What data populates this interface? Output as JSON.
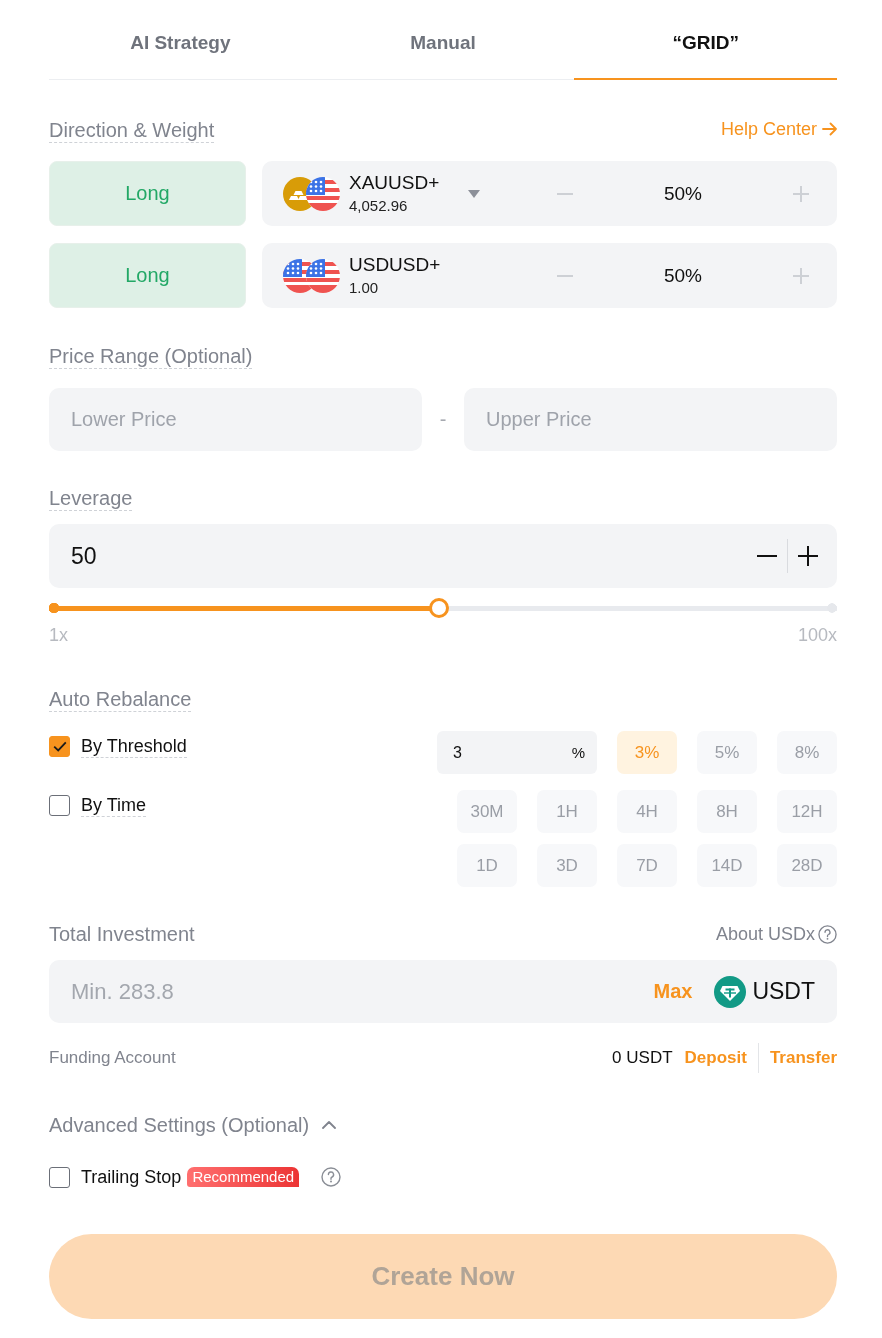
{
  "tabs": [
    {
      "label": "AI Strategy",
      "selected": false
    },
    {
      "label": "Manual",
      "selected": false
    },
    {
      "label": "“GRID”",
      "selected": true
    }
  ],
  "direction_weight": {
    "title": "Direction & Weight",
    "help_link": "Help Center",
    "rows": [
      {
        "direction": "Long",
        "asset": {
          "symbol": "XAUUSD+",
          "price": "4,052.96",
          "kind": "metal",
          "dropdown": true
        },
        "weight": "50%"
      },
      {
        "direction": "Long",
        "asset": {
          "symbol": "USDUSD+",
          "price": "1.00",
          "kind": "fiat",
          "dropdown": false
        },
        "weight": "50%"
      }
    ]
  },
  "price_range": {
    "title": "Price Range (Optional)",
    "lower": {
      "placeholder": "Lower Price"
    },
    "separator": "-",
    "upper": {
      "placeholder": "Upper Price"
    }
  },
  "leverage": {
    "title": "Leverage",
    "value": "50",
    "slider": {
      "level": 0.495,
      "min_label": "1x",
      "max_label": "100x"
    }
  },
  "auto_rebalance": {
    "title": "Auto Rebalance",
    "threshold": {
      "label": "By Threshold",
      "checked": true,
      "input": {
        "value": "3",
        "unit": "%"
      },
      "options": [
        {
          "label": "3%",
          "selected": true
        },
        {
          "label": "5%",
          "selected": false
        },
        {
          "label": "8%",
          "selected": false
        }
      ]
    },
    "time": {
      "label": "By Time",
      "checked": false,
      "options": [
        {
          "label": "30M",
          "selected": false
        },
        {
          "label": "1H",
          "selected": false
        },
        {
          "label": "4H",
          "selected": false
        },
        {
          "label": "8H",
          "selected": false
        },
        {
          "label": "12H",
          "selected": false
        },
        {
          "label": "1D",
          "selected": false
        },
        {
          "label": "3D",
          "selected": false
        },
        {
          "label": "7D",
          "selected": false
        },
        {
          "label": "14D",
          "selected": false
        },
        {
          "label": "28D",
          "selected": false
        }
      ]
    }
  },
  "total_investment": {
    "title": "Total Investment",
    "about_link": "About USDx",
    "input": {
      "placeholder": "Min. 283.8"
    },
    "max_label": "Max",
    "currency": "USDT"
  },
  "funding_account": {
    "label": "Funding Account",
    "balance": "0 USDT",
    "actions": [
      "Deposit",
      "Transfer"
    ]
  },
  "advanced_settings": {
    "title": "Advanced Settings (Optional)",
    "expanded": true,
    "trailing_stop": {
      "label": "Trailing Stop",
      "checked": false,
      "badge": "Recommended"
    }
  },
  "submit": {
    "label": "Create Now",
    "disabled": true
  }
}
